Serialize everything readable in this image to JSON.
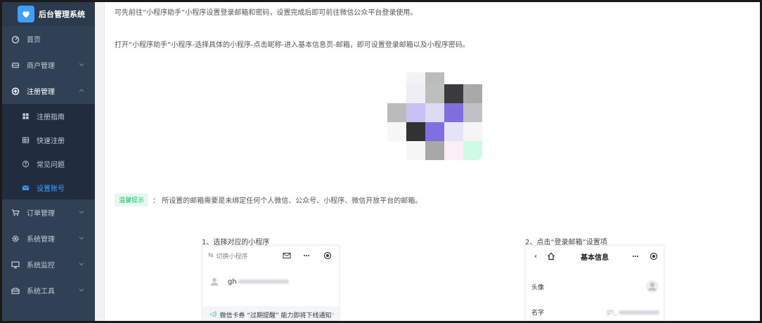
{
  "app": {
    "title": "后台管理系统"
  },
  "sidebar": {
    "items": [
      {
        "label": "首页",
        "icon": "dashboard-icon"
      },
      {
        "label": "商户管理",
        "icon": "store-icon"
      },
      {
        "label": "注册管理",
        "icon": "plus-circle-icon",
        "expanded": true,
        "children": [
          {
            "label": "注册指南",
            "icon": "grid-icon"
          },
          {
            "label": "快速注册",
            "icon": "table-icon"
          },
          {
            "label": "常见问题",
            "icon": "question-icon"
          },
          {
            "label": "设置账号",
            "icon": "mail-icon",
            "active": true
          }
        ]
      },
      {
        "label": "订单管理",
        "icon": "cart-icon"
      },
      {
        "label": "系统管理",
        "icon": "gear-icon"
      },
      {
        "label": "系统监控",
        "icon": "monitor-icon"
      },
      {
        "label": "系统工具",
        "icon": "toolbox-icon"
      }
    ]
  },
  "content": {
    "para1": "可先前往“小程序助手”小程序设置登录邮箱和密码，设置完成后即可前往微信公众平台登录使用。",
    "para2": "打开“小程序助手”小程序-选择具体的小程序-点击昵称-进入基本信息页-邮箱，即可设置登录邮箱以及小程序密码。",
    "tip_badge": "温馨提示",
    "tip_text": "：  所设置的邮箱需要是未绑定任何个人微信、公众号、小程序、微信开放平台的邮箱。",
    "step1": {
      "label": "1、选择对应的小程序",
      "switch_label": "切换小程序",
      "account_prefix": "gh",
      "notice": "微信卡券 “过期提醒” 能力即将下线通知"
    },
    "step2": {
      "label": "2、点击“登录邮箱”设置项",
      "title": "基本信息",
      "row_avatar": "头像",
      "row_name": "名字",
      "name_prefix": "gh_"
    }
  },
  "colors": {
    "sidebar_bg": "#304156",
    "submenu_bg": "#1f2d3d",
    "accent": "#409eff",
    "tip_green": "#19be6b"
  }
}
